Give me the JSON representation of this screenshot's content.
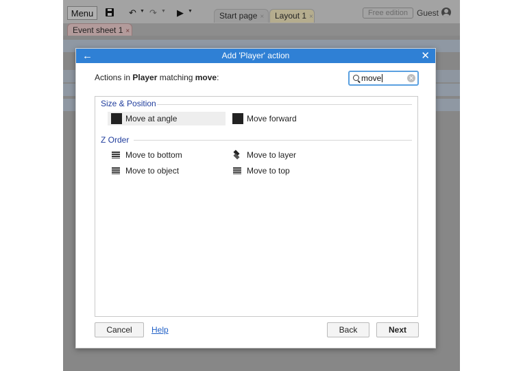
{
  "toolbar": {
    "menu_label": "Menu",
    "undo_icon": "undo-icon",
    "redo_icon": "redo-icon",
    "play_icon": "play-icon"
  },
  "tabs": [
    {
      "label": "Start page",
      "close": "×"
    },
    {
      "label": "Layout 1",
      "close": "×"
    },
    {
      "label": "Event sheet 1",
      "close": "×"
    }
  ],
  "account": {
    "edition_label": "Free edition",
    "user_label": "Guest"
  },
  "dialog": {
    "title": "Add 'Player' action",
    "back_glyph": "←",
    "close_glyph": "✕",
    "prompt_prefix": "Actions in ",
    "object_name": "Player",
    "prompt_mid": " matching ",
    "query": "move",
    "prompt_suffix": ":",
    "search_value": "move",
    "categories": [
      {
        "name": "Size & Position",
        "items": [
          {
            "label": "Move at angle",
            "icon": "square-icon",
            "selected": true
          },
          {
            "label": "Move forward",
            "icon": "square-icon",
            "selected": false
          }
        ]
      },
      {
        "name": "Z Order",
        "items": [
          {
            "label": "Move to bottom",
            "icon": "z-order-icon"
          },
          {
            "label": "Move to layer",
            "icon": "layers-icon"
          },
          {
            "label": "Move to object",
            "icon": "z-order-icon"
          },
          {
            "label": "Move to top",
            "icon": "z-order-icon"
          }
        ]
      }
    ],
    "buttons": {
      "cancel": "Cancel",
      "help": "Help",
      "back": "Back",
      "next": "Next"
    }
  },
  "colors": {
    "title_bar": "#2f80d5",
    "category_text": "#1f3c9c",
    "link": "#1f5fc6"
  }
}
